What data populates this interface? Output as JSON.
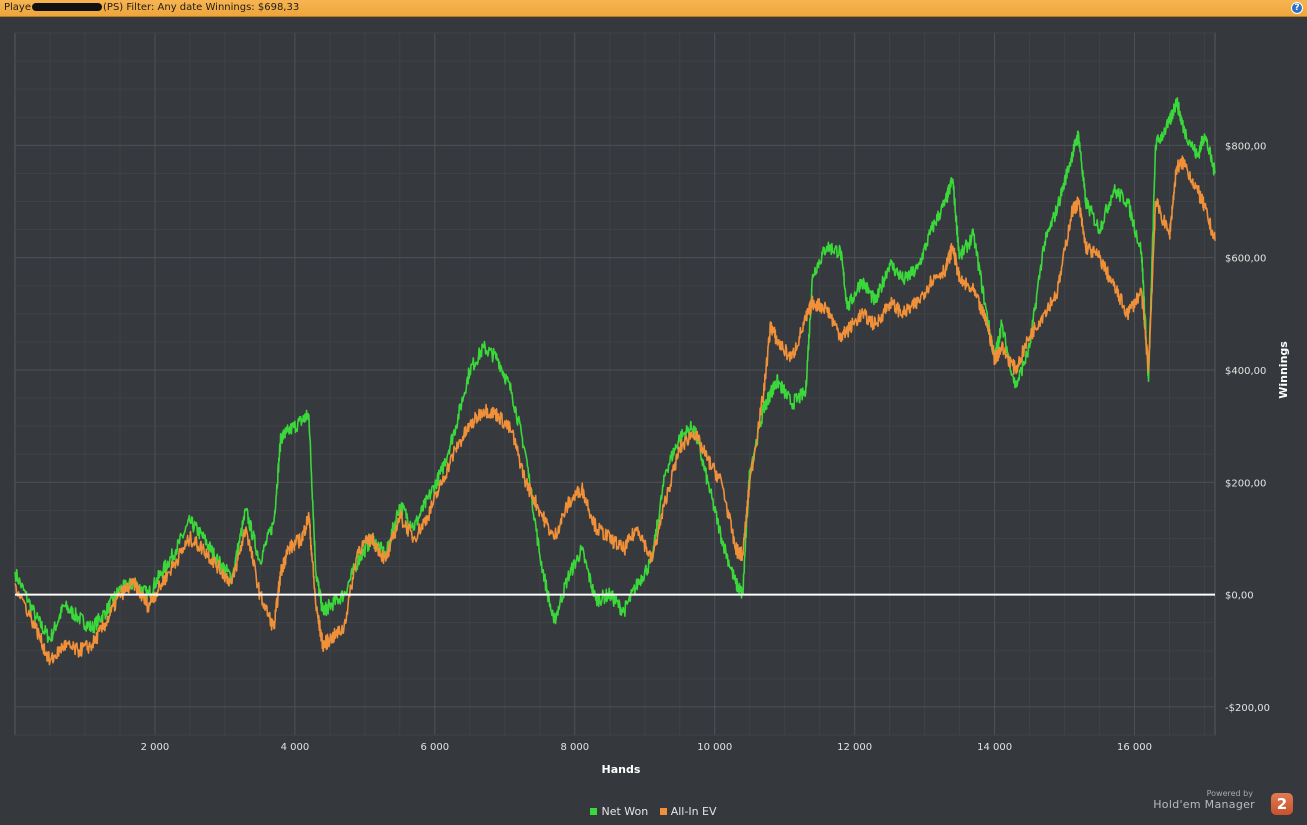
{
  "window": {
    "title_prefix": "Playe",
    "title_suffix": "(PS) Filter: Any date  Winnings: $698,33",
    "help_label": "?"
  },
  "chart_data": {
    "type": "line",
    "xlabel": "Hands",
    "ylabel": "Winnings",
    "xlim": [
      0,
      17150
    ],
    "ylim": [
      -250,
      1000
    ],
    "x_ticks": [
      2000,
      4000,
      6000,
      8000,
      10000,
      12000,
      14000,
      16000
    ],
    "x_tick_labels": [
      "2 000",
      "4 000",
      "6 000",
      "8 000",
      "10 000",
      "12 000",
      "14 000",
      "16 000"
    ],
    "y_ticks": [
      -200,
      0,
      200,
      400,
      600,
      800
    ],
    "y_tick_labels": [
      "-$200,00",
      "$0,00",
      "$200,00",
      "$400,00",
      "$600,00",
      "$800,00"
    ],
    "grid": true,
    "legend_position": "bottom-center",
    "series": [
      {
        "name": "Net Won",
        "color": "#3ad83a",
        "x": [
          0,
          300,
          500,
          700,
          900,
          1100,
          1300,
          1500,
          1700,
          1900,
          2100,
          2300,
          2500,
          2700,
          2900,
          3100,
          3300,
          3500,
          3700,
          3800,
          3900,
          4100,
          4200,
          4300,
          4400,
          4500,
          4700,
          4900,
          5100,
          5300,
          5500,
          5700,
          5900,
          6100,
          6300,
          6500,
          6700,
          6900,
          7100,
          7300,
          7500,
          7700,
          7900,
          8100,
          8300,
          8500,
          8700,
          8900,
          9100,
          9300,
          9500,
          9700,
          9900,
          10100,
          10300,
          10400,
          10500,
          10700,
          10800,
          10900,
          11100,
          11300,
          11400,
          11600,
          11800,
          11900,
          12100,
          12300,
          12500,
          12700,
          12900,
          13100,
          13300,
          13400,
          13500,
          13700,
          13900,
          14000,
          14100,
          14300,
          14500,
          14700,
          14900,
          15100,
          15200,
          15300,
          15500,
          15700,
          15900,
          16100,
          16200,
          16300,
          16500,
          16600,
          16700,
          16900,
          17000,
          17150
        ],
        "y": [
          40,
          -40,
          -80,
          -20,
          -40,
          -60,
          -30,
          10,
          20,
          0,
          40,
          80,
          130,
          100,
          60,
          30,
          150,
          60,
          130,
          280,
          290,
          310,
          320,
          40,
          -30,
          -20,
          0,
          60,
          100,
          70,
          160,
          120,
          170,
          220,
          300,
          400,
          440,
          420,
          360,
          250,
          70,
          -50,
          30,
          80,
          -10,
          0,
          -30,
          20,
          60,
          220,
          280,
          300,
          200,
          100,
          20,
          0,
          220,
          330,
          360,
          380,
          340,
          360,
          570,
          620,
          610,
          510,
          560,
          520,
          590,
          560,
          580,
          650,
          700,
          740,
          600,
          640,
          490,
          420,
          480,
          370,
          440,
          620,
          690,
          780,
          820,
          700,
          650,
          720,
          700,
          610,
          380,
          800,
          840,
          880,
          830,
          780,
          820,
          750
        ]
      },
      {
        "name": "All-In EV",
        "color": "#f0913a",
        "x": [
          0,
          300,
          500,
          700,
          900,
          1100,
          1300,
          1500,
          1700,
          1900,
          2100,
          2300,
          2500,
          2700,
          2900,
          3100,
          3300,
          3500,
          3700,
          3800,
          3900,
          4100,
          4200,
          4300,
          4400,
          4500,
          4700,
          4900,
          5100,
          5300,
          5500,
          5700,
          5900,
          6100,
          6300,
          6500,
          6700,
          6900,
          7100,
          7300,
          7500,
          7700,
          7900,
          8100,
          8300,
          8500,
          8700,
          8900,
          9100,
          9300,
          9500,
          9700,
          9900,
          10100,
          10300,
          10400,
          10500,
          10700,
          10800,
          10900,
          11100,
          11300,
          11400,
          11600,
          11800,
          11900,
          12100,
          12300,
          12500,
          12700,
          12900,
          13100,
          13300,
          13400,
          13500,
          13700,
          13900,
          14000,
          14100,
          14300,
          14500,
          14700,
          14900,
          15100,
          15200,
          15300,
          15500,
          15700,
          15900,
          16100,
          16200,
          16300,
          16500,
          16600,
          16700,
          16900,
          17000,
          17150
        ],
        "y": [
          20,
          -60,
          -120,
          -90,
          -100,
          -90,
          -50,
          0,
          20,
          -20,
          20,
          60,
          100,
          80,
          50,
          20,
          120,
          0,
          -60,
          40,
          80,
          100,
          140,
          -20,
          -90,
          -80,
          -60,
          80,
          100,
          60,
          140,
          100,
          140,
          200,
          260,
          300,
          330,
          320,
          290,
          200,
          150,
          100,
          160,
          190,
          120,
          100,
          80,
          120,
          60,
          170,
          260,
          290,
          240,
          200,
          80,
          70,
          200,
          360,
          480,
          450,
          420,
          490,
          520,
          510,
          460,
          470,
          500,
          480,
          520,
          500,
          520,
          560,
          580,
          620,
          560,
          540,
          480,
          420,
          440,
          400,
          460,
          500,
          540,
          680,
          700,
          620,
          600,
          550,
          500,
          540,
          400,
          700,
          640,
          760,
          770,
          720,
          690,
          630
        ]
      }
    ]
  },
  "brand": {
    "powered_by": "Powered by",
    "name": "Hold'em Manager",
    "logo_number": "2"
  }
}
